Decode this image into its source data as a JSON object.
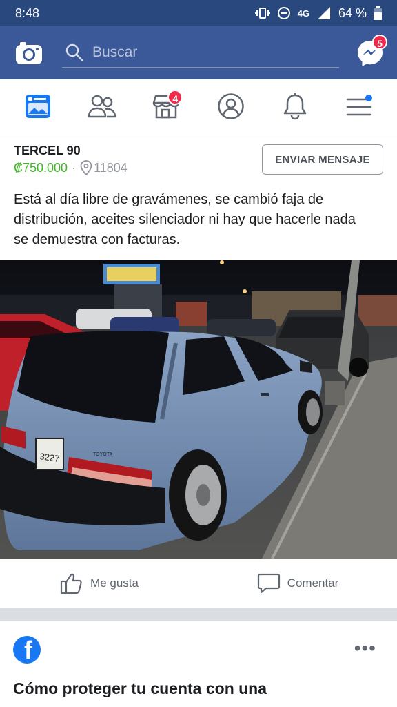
{
  "status": {
    "time": "8:48",
    "network": "4G",
    "battery": "64 %"
  },
  "header": {
    "search_placeholder": "Buscar",
    "messenger_badge": "5"
  },
  "nav": {
    "marketplace_badge": "4"
  },
  "listing": {
    "title": "TERCEL 90",
    "price": "₡750.000",
    "separator": "·",
    "location": "11804",
    "message_button": "ENVIAR MENSAJE",
    "description": "Está al día libre de gravámenes, se cambió faja de distribución, aceites silenciador ni hay que hacerle nada se demuestra con facturas.",
    "photo": {
      "plate": "3227",
      "car_brand": "TOYOTA"
    }
  },
  "actions": {
    "like": "Me gusta",
    "comment": "Comentar"
  },
  "next_post": {
    "title": "Cómo proteger tu cuenta con una",
    "more": "•••"
  },
  "colors": {
    "header_bg": "#3b5998",
    "status_bg": "#29487d",
    "price": "#42b72a",
    "badge": "#f02849"
  }
}
